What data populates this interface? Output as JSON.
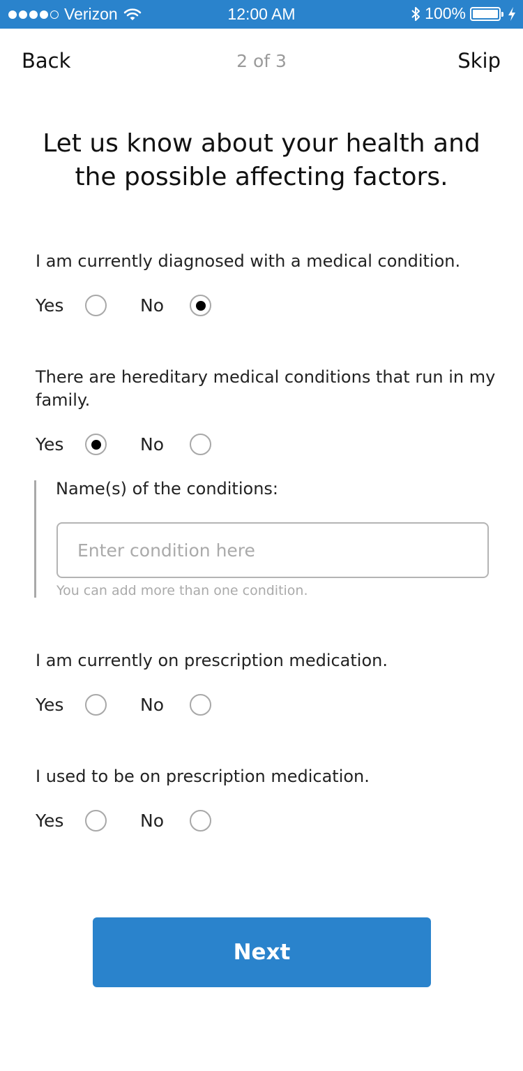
{
  "status_bar": {
    "carrier": "Verizon",
    "time": "12:00 AM",
    "battery": "100%",
    "signal_bars_filled": 4,
    "signal_bars_total": 5
  },
  "nav": {
    "back_label": "Back",
    "step_label": "2 of 3",
    "skip_label": "Skip"
  },
  "title": "Let us know about your health and the possible affecting factors.",
  "questions": [
    {
      "text": "I am currently diagnosed with a medical condition.",
      "yes_label": "Yes",
      "no_label": "No",
      "selected": "No"
    },
    {
      "text": "There are hereditary medical conditions that run in my family.",
      "yes_label": "Yes",
      "no_label": "No",
      "selected": "Yes"
    },
    {
      "text": "I am currently on prescription medication.",
      "yes_label": "Yes",
      "no_label": "No",
      "selected": null
    },
    {
      "text": "I used to be on prescription medication.",
      "yes_label": "Yes",
      "no_label": "No",
      "selected": null
    }
  ],
  "conditions": {
    "label": "Name(s) of the conditions:",
    "value": "",
    "placeholder": "Enter condition here",
    "hint": "You can add more than one condition."
  },
  "next_label": "Next",
  "colors": {
    "accent": "#2a83cc",
    "text": "#222222",
    "muted": "#aaaaaa"
  },
  "icons": [
    "wifi-icon",
    "bluetooth-icon",
    "battery-icon",
    "charging-icon"
  ]
}
